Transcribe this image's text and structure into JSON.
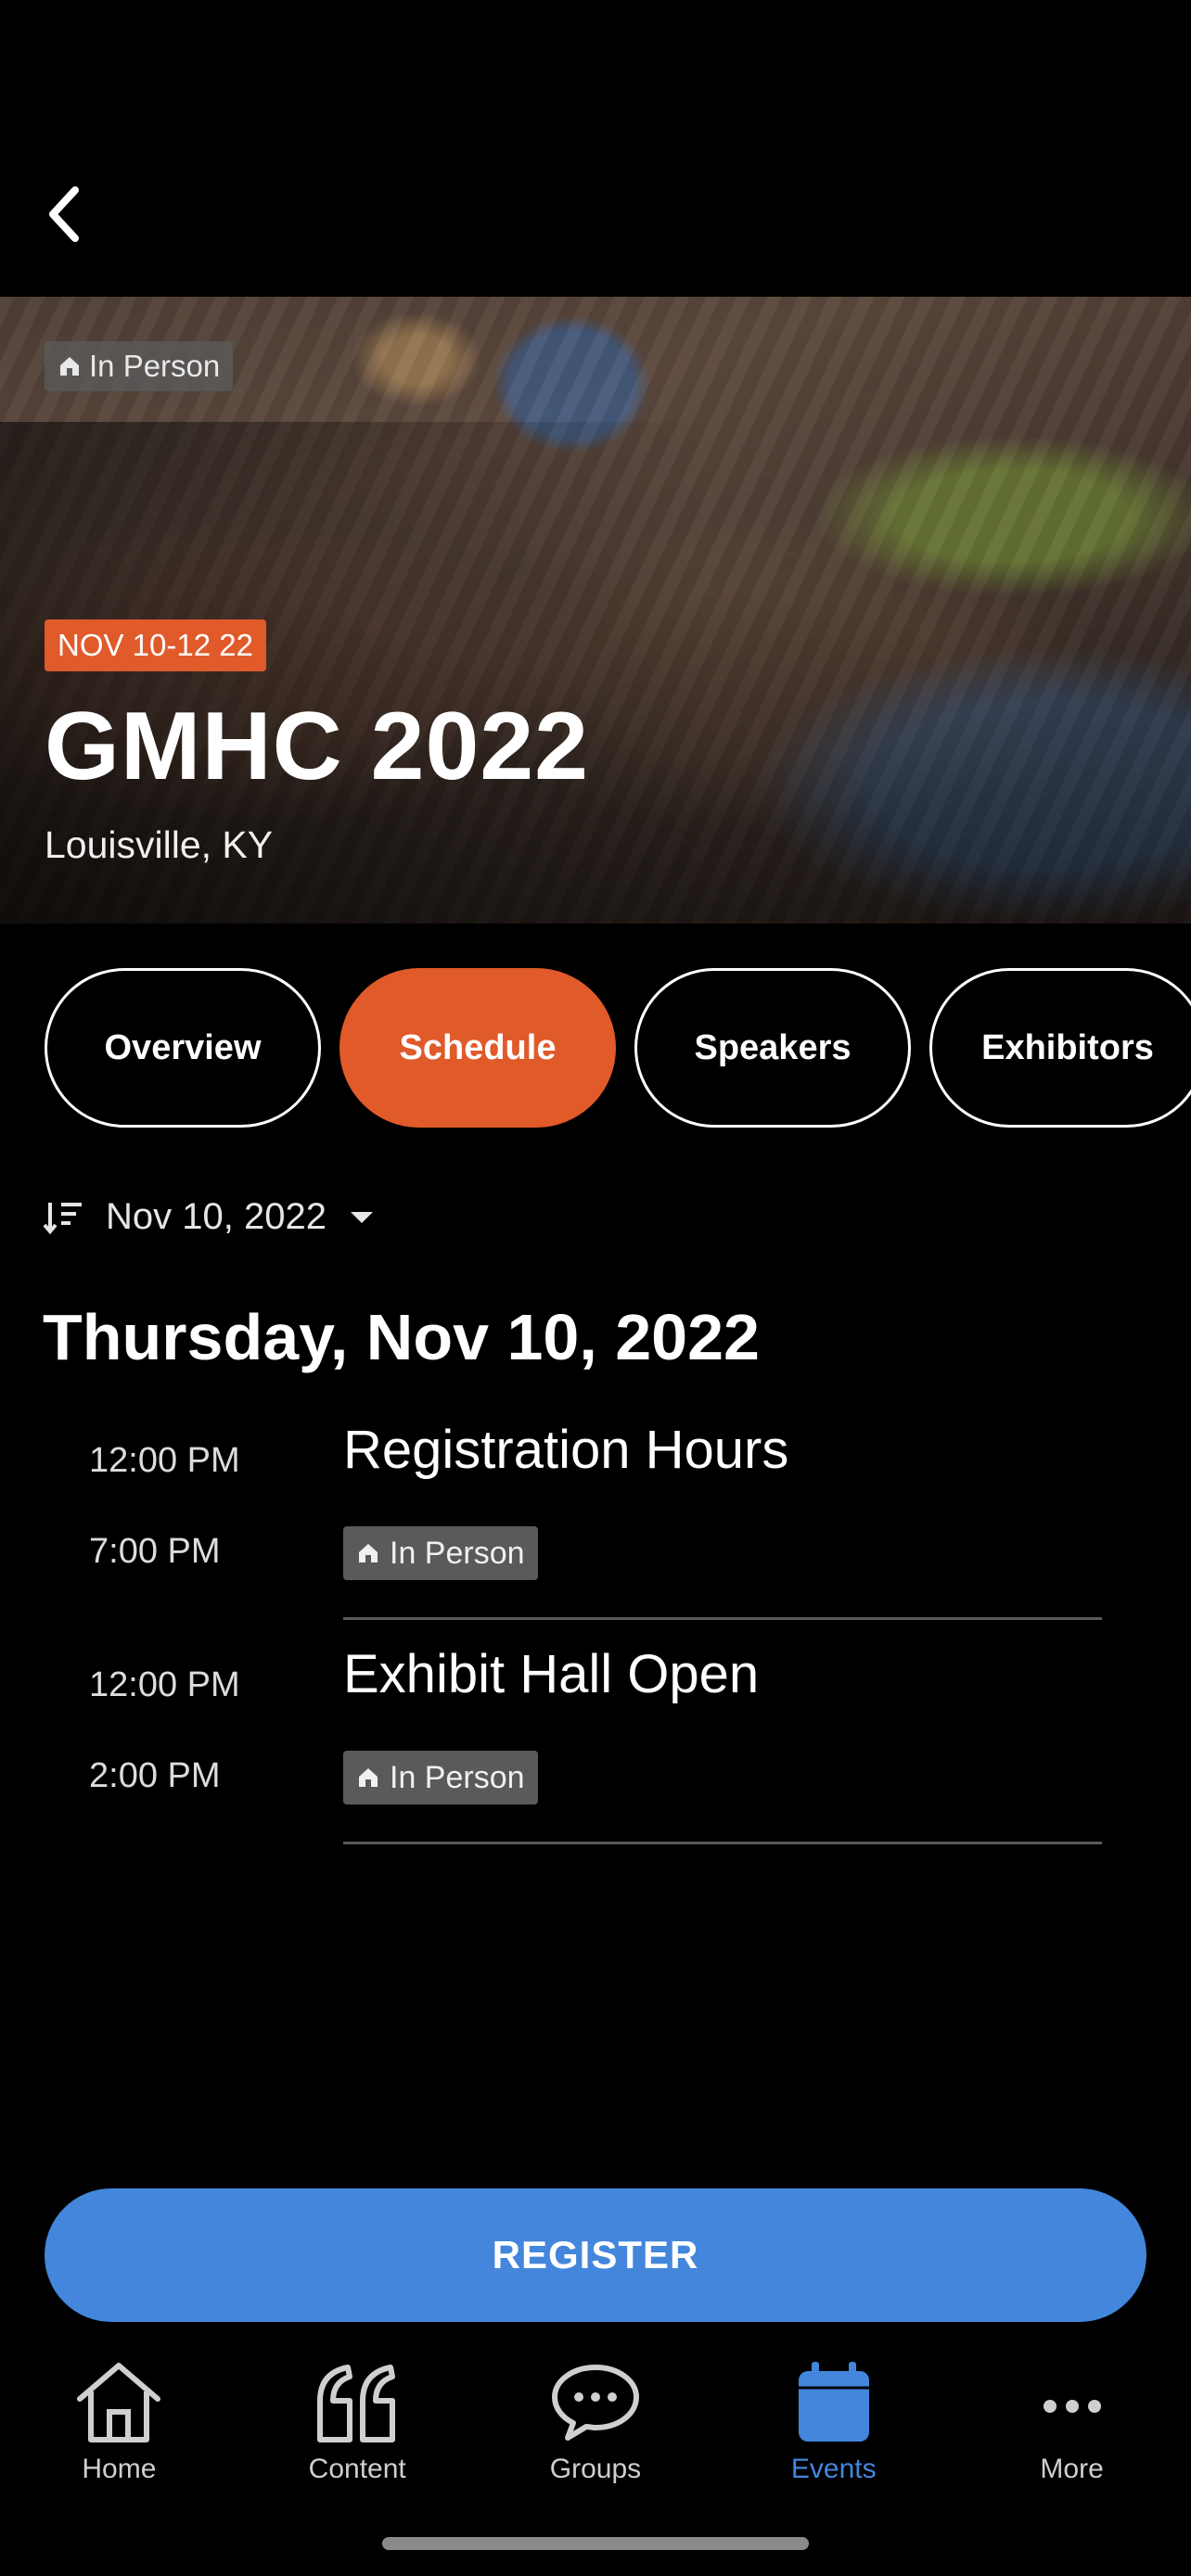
{
  "hero": {
    "format_badge": "In Person",
    "date_badge": "NOV 10-12 22",
    "title": "GMHC 2022",
    "location": "Louisville, KY"
  },
  "tabs": [
    {
      "label": "Overview",
      "active": false
    },
    {
      "label": "Schedule",
      "active": true
    },
    {
      "label": "Speakers",
      "active": false
    },
    {
      "label": "Exhibitors",
      "active": false
    }
  ],
  "filter": {
    "selected_date": "Nov 10, 2022"
  },
  "schedule": {
    "day_heading": "Thursday, Nov 10, 2022",
    "sessions": [
      {
        "start": "12:00 PM",
        "end": "7:00 PM",
        "title": "Registration Hours",
        "badge": "In Person"
      },
      {
        "start": "12:00 PM",
        "end": "2:00 PM",
        "title": "Exhibit Hall Open",
        "badge": "In Person"
      }
    ]
  },
  "register_label": "REGISTER",
  "nav": [
    {
      "label": "Home",
      "icon": "home-icon"
    },
    {
      "label": "Content",
      "icon": "quote-icon"
    },
    {
      "label": "Groups",
      "icon": "chat-icon"
    },
    {
      "label": "Events",
      "icon": "calendar-icon",
      "active": true
    },
    {
      "label": "More",
      "icon": "more-icon"
    }
  ],
  "colors": {
    "accent": "#e05a2a",
    "primary": "#4386dc",
    "background": "#000000"
  }
}
